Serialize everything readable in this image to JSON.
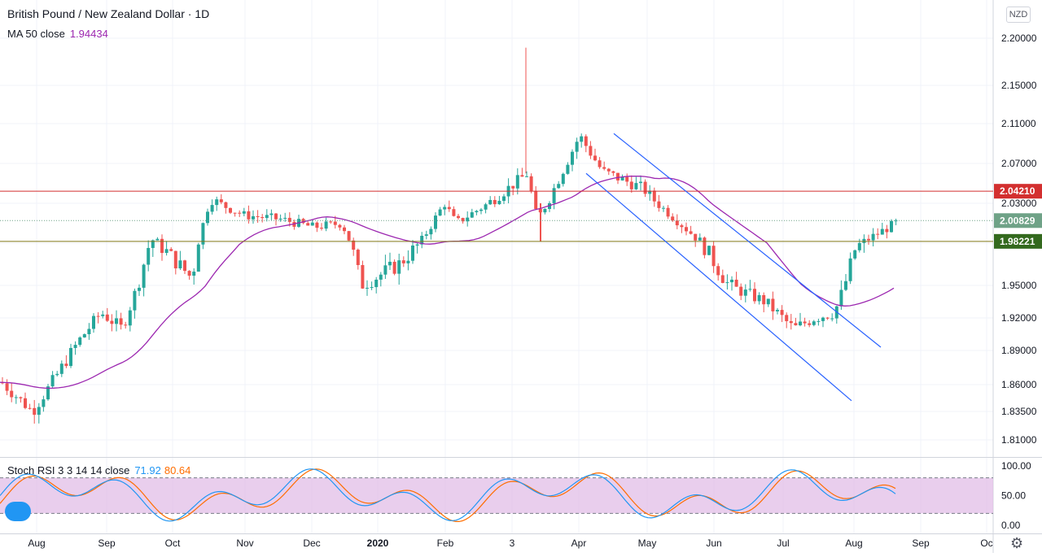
{
  "header": {
    "title": "British Pound / New Zealand Dollar · 1D",
    "ma_label": "MA 50 close",
    "ma_value": "1.94434",
    "currency": "NZD"
  },
  "stoch": {
    "label": "Stoch RSI 3 3 14 14 close",
    "k_value": "71.92",
    "d_value": "80.64"
  },
  "colors": {
    "up": "#26a69a",
    "down": "#ef5350",
    "ma": "#9c27b0",
    "channel": "#2962ff",
    "resistance": "#d32f2f",
    "support": "#827717",
    "last_price": "#6fa287",
    "stoch_k": "#2196f3",
    "stoch_d": "#ff6d00",
    "stoch_band": "#e1bee7"
  },
  "chart_data": [
    {
      "type": "candlestick",
      "y_ticks": [
        "2.20000",
        "2.15000",
        "2.11000",
        "2.07000",
        "2.03000",
        "1.98000",
        "1.95000",
        "1.92000",
        "1.89000",
        "1.86000",
        "1.83500",
        "1.81000"
      ],
      "x_ticks": [
        "Aug",
        "Sep",
        "Oct",
        "Nov",
        "Dec",
        "2020",
        "Feb",
        "3",
        "Apr",
        "May",
        "Jun",
        "Jul",
        "Aug",
        "Sep",
        "Oc"
      ],
      "ohlc_waypoints": [
        [
          "Aug",
          1.862
        ],
        [
          "Aug",
          1.835
        ],
        [
          "Sep",
          1.9
        ],
        [
          "Sep",
          1.925
        ],
        [
          "Sep",
          1.91
        ],
        [
          "Oct",
          1.985
        ],
        [
          "Oct",
          1.955
        ],
        [
          "Oct",
          2.035
        ],
        [
          "Nov",
          2.015
        ],
        [
          "Nov",
          2.01
        ],
        [
          "Dec",
          2.0
        ],
        [
          "Dec",
          2.005
        ],
        [
          "Dec",
          1.95
        ],
        [
          "2020",
          1.965
        ],
        [
          "2020",
          1.98
        ],
        [
          "Feb",
          2.03
        ],
        [
          "Feb",
          2.005
        ],
        [
          "3",
          2.06
        ],
        [
          "3",
          2.01
        ],
        [
          "Apr",
          2.098
        ],
        [
          "Apr",
          2.062
        ],
        [
          "May",
          2.045
        ],
        [
          "May",
          2.01
        ],
        [
          "Jun",
          1.95
        ],
        [
          "Jun",
          1.935
        ],
        [
          "Jul",
          1.91
        ],
        [
          "Jul",
          1.92
        ],
        [
          "Aug",
          1.925
        ],
        [
          "Aug",
          1.975
        ],
        [
          "Aug",
          2.005
        ]
      ],
      "moving_average": {
        "name": "MA 50 close",
        "last": 1.94434
      },
      "levels": {
        "resistance": 2.0421,
        "last_price": 2.00829,
        "support": 1.98221
      },
      "price_labels": {
        "resistance": "2.04210",
        "last_price": "2.00829",
        "support": "1.98221"
      },
      "channel": {
        "start_month": "Apr",
        "end_month": "Aug",
        "upper": [
          2.1,
          1.893
        ],
        "lower": [
          2.06,
          1.845
        ]
      }
    },
    {
      "type": "line",
      "name": "Stoch RSI 3 3 14 14 close",
      "y_ticks": [
        "100.00",
        "50.00",
        "0.00"
      ],
      "bands": [
        20,
        80
      ],
      "series": [
        {
          "name": "K",
          "last": 71.92
        },
        {
          "name": "D",
          "last": 80.64
        }
      ]
    }
  ]
}
